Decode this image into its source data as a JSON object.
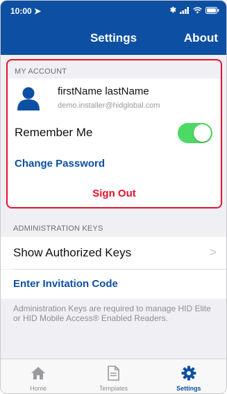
{
  "status_bar": {
    "time": "10:00",
    "icons": [
      "location-arrow-icon",
      "bluetooth-icon",
      "signal-icon",
      "wifi-icon",
      "battery-icon"
    ]
  },
  "nav": {
    "title": "Settings",
    "about_label": "About"
  },
  "my_account": {
    "header": "MY ACCOUNT",
    "name": "firstName lastName",
    "email": "demo.installer@hidglobal.com",
    "remember_me_label": "Remember Me",
    "remember_me_on": true,
    "change_password_label": "Change Password",
    "sign_out_label": "Sign Out"
  },
  "admin_keys": {
    "header": "ADMINISTRATION KEYS",
    "show_keys_label": "Show Authorized Keys",
    "invite_label": "Enter Invitation Code",
    "note": "Administration Keys are required to manage HID Elite or HID Mobile Access® Enabled Readers."
  },
  "tabs": [
    {
      "label": "Home",
      "icon": "home-icon",
      "active": false
    },
    {
      "label": "Templates",
      "icon": "document-icon",
      "active": false
    },
    {
      "label": "Settings",
      "icon": "gear-icon",
      "active": true
    }
  ],
  "colors": {
    "brand_blue": "#0d4fa3",
    "highlight_red": "#e8102b",
    "toggle_green": "#4cd964"
  }
}
